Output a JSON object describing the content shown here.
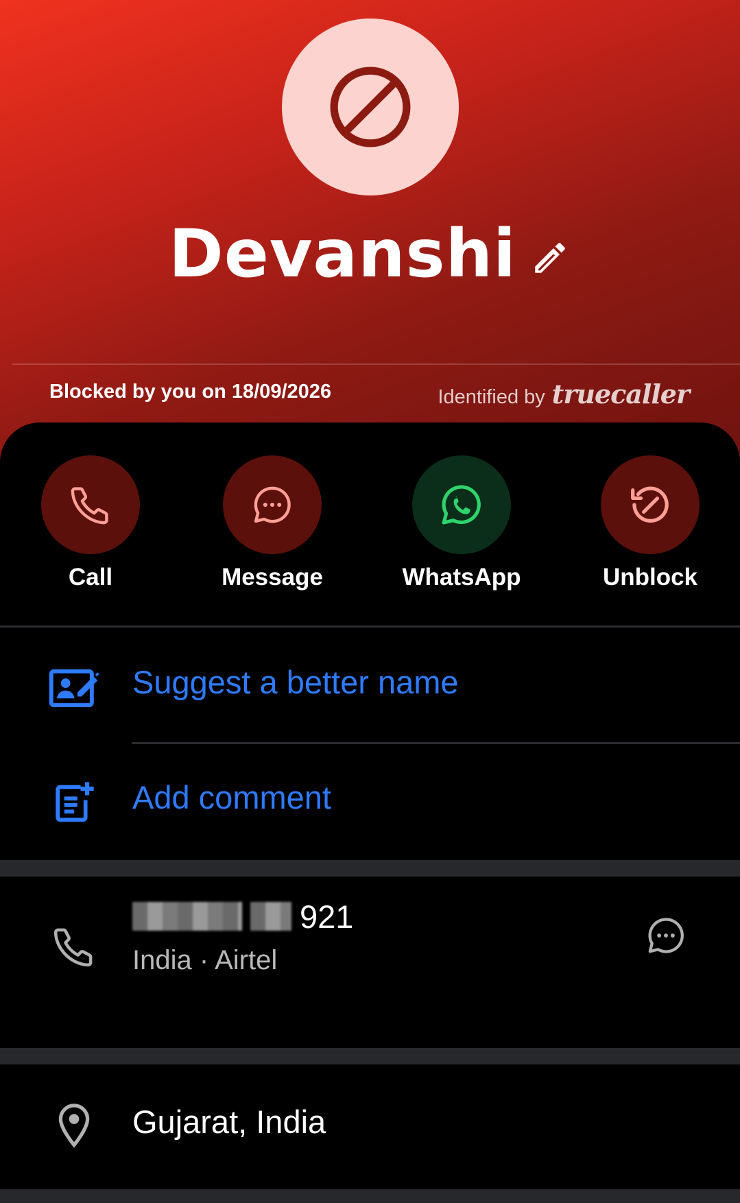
{
  "contact": {
    "name": "Devanshi",
    "blocked_text": "Blocked by you on 18/09/2026",
    "identified_prefix": "Identified by",
    "identified_brand": "truecaller"
  },
  "actions": [
    {
      "label": "Call",
      "icon": "phone-icon"
    },
    {
      "label": "Message",
      "icon": "chat-bubble-icon"
    },
    {
      "label": "WhatsApp",
      "icon": "whatsapp-icon"
    },
    {
      "label": "Unblock",
      "icon": "unblock-icon"
    }
  ],
  "links": {
    "suggest_name": "Suggest a better name",
    "add_comment": "Add comment"
  },
  "phone": {
    "visible_suffix": "921",
    "carrier_line": "India · Airtel"
  },
  "location": {
    "text": "Gujarat, India"
  },
  "colors": {
    "header_top": "#f0321f",
    "header_bottom": "#6e120f",
    "avatar_bg": "#fcd3cf",
    "block_icon": "#8b1a10",
    "action_red_bg": "#5b100c",
    "action_red_icon": "#ff9f96",
    "action_green_bg": "#0a2e1a",
    "action_green_icon": "#2fd36b",
    "link_blue": "#2f7bff",
    "background": "#000000"
  }
}
